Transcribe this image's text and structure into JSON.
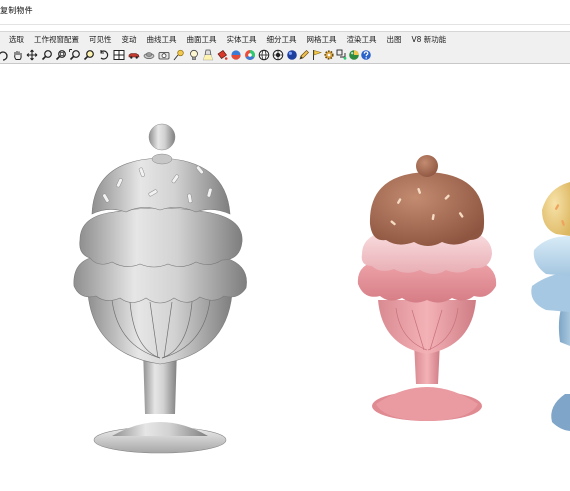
{
  "window": {
    "title": "复制物件"
  },
  "tabs": [
    {
      "label": "选取"
    },
    {
      "label": "工作视窗配置"
    },
    {
      "label": "可见性"
    },
    {
      "label": "变动"
    },
    {
      "label": "曲线工具"
    },
    {
      "label": "曲面工具"
    },
    {
      "label": "实体工具"
    },
    {
      "label": "细分工具"
    },
    {
      "label": "网格工具"
    },
    {
      "label": "渲染工具"
    },
    {
      "label": "出图"
    },
    {
      "label": "V8 新功能"
    }
  ],
  "toolbar": {
    "tools": [
      {
        "icon": "rotate-view-icon"
      },
      {
        "icon": "pan-hand-icon"
      },
      {
        "icon": "move-icon"
      },
      {
        "icon": "zoom-icon"
      },
      {
        "icon": "zoom-window-icon"
      },
      {
        "icon": "zoom-extents-icon"
      },
      {
        "icon": "zoom-selected-icon"
      },
      {
        "icon": "undo-view-icon"
      },
      {
        "icon": "four-viewports-icon"
      },
      {
        "icon": "car-icon"
      },
      {
        "icon": "ghosted-icon"
      },
      {
        "icon": "camera-icon"
      },
      {
        "icon": "named-view-icon"
      },
      {
        "icon": "light-bulb-icon"
      },
      {
        "icon": "spotlight-icon"
      },
      {
        "icon": "paint-bucket-icon"
      },
      {
        "icon": "material-sphere-icon"
      },
      {
        "icon": "color-wheel-icon"
      },
      {
        "icon": "globe-icon"
      },
      {
        "icon": "render-preview-icon"
      },
      {
        "icon": "blue-sphere-icon"
      },
      {
        "icon": "pencil-icon"
      },
      {
        "icon": "flag-icon"
      },
      {
        "icon": "gear-icon"
      },
      {
        "icon": "shape-tools-icon"
      },
      {
        "icon": "color-sphere-icon"
      },
      {
        "icon": "help-icon"
      }
    ]
  },
  "colors": {
    "chrome": "#f0f0f0",
    "model_gray": "#d8d8d8",
    "chocolate": "#a86b52",
    "pink_cream": "#f0bcc2",
    "strawberry": "#e58f97",
    "vanilla": "#f0d28a",
    "blue_cream": "#bcd9ee"
  }
}
